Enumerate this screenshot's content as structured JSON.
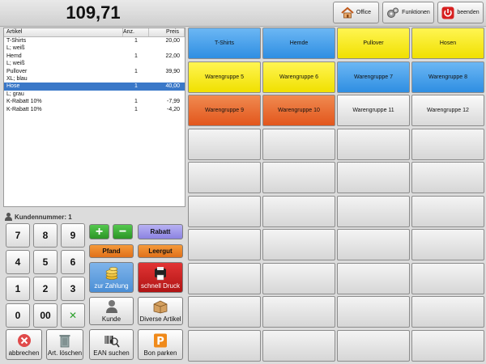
{
  "header": {
    "total": "109,71",
    "buttons": [
      {
        "label": "Office",
        "icon": "house-icon"
      },
      {
        "label": "Funktionen",
        "icon": "gears-icon"
      },
      {
        "label": "beenden",
        "icon": "power-icon"
      }
    ]
  },
  "receipt": {
    "columns": [
      "Artikel",
      "Anz.",
      "Preis"
    ],
    "rows": [
      {
        "artikel": "T-Shirts",
        "anz": "1",
        "preis": "20,00",
        "selected": false
      },
      {
        "artikel": "L; weiß",
        "anz": "",
        "preis": "",
        "selected": false
      },
      {
        "artikel": "Hemd",
        "anz": "1",
        "preis": "22,00",
        "selected": false
      },
      {
        "artikel": "L; weiß",
        "anz": "",
        "preis": "",
        "selected": false
      },
      {
        "artikel": "Pullover",
        "anz": "1",
        "preis": "39,90",
        "selected": false
      },
      {
        "artikel": "XL; blau",
        "anz": "",
        "preis": "",
        "selected": false
      },
      {
        "artikel": "Hose",
        "anz": "1",
        "preis": "40,00",
        "selected": true
      },
      {
        "artikel": "L; grau",
        "anz": "",
        "preis": "",
        "selected": false
      },
      {
        "artikel": "K-Rabatt 10%",
        "anz": "1",
        "preis": "-7,99",
        "selected": false
      },
      {
        "artikel": "K-Rabatt 10%",
        "anz": "1",
        "preis": "-4,20",
        "selected": false
      }
    ]
  },
  "customer": {
    "label": "Kundennummer: 1"
  },
  "keypad": {
    "keys": [
      "7",
      "8",
      "9",
      "4",
      "5",
      "6",
      "1",
      "2",
      "3",
      "0",
      "00",
      "✕"
    ]
  },
  "functions": {
    "plus": "+",
    "minus": "−",
    "rabatt": "Rabatt",
    "pfand": "Pfand",
    "leergut": "Leergut",
    "zahlung": "zur Zahlung",
    "schnell_druck": "schnell Druck",
    "kunde": "Kunde",
    "diverse": "Diverse Artikel",
    "abbrechen": "abbrechen",
    "art_loeschen": "Art. löschen",
    "ean_suchen": "EAN suchen",
    "bon_parken": "Bon parken"
  },
  "product_tiles": [
    {
      "label": "T-Shirts",
      "color": "blue"
    },
    {
      "label": "Hemde",
      "color": "blue"
    },
    {
      "label": "Pullover",
      "color": "yellow"
    },
    {
      "label": "Hosen",
      "color": "yellow"
    },
    {
      "label": "Warengruppe 5",
      "color": "yellow"
    },
    {
      "label": "Warengruppe 6",
      "color": "yellow"
    },
    {
      "label": "Warengruppe 7",
      "color": "blue"
    },
    {
      "label": "Warengruppe 8",
      "color": "blue"
    },
    {
      "label": "Warengruppe 9",
      "color": "orange"
    },
    {
      "label": "Warengruppe 10",
      "color": "orange"
    },
    {
      "label": "Warengruppe 11",
      "color": "grey"
    },
    {
      "label": "Warengruppe 12",
      "color": "grey"
    }
  ],
  "colors": {
    "selection": "#3a78c8",
    "tile_blue": "#2e8ee2",
    "tile_yellow": "#f0e000",
    "tile_orange": "#e2561c",
    "zahlung_blue": "#4b8fd6",
    "druck_red": "#b01414"
  }
}
